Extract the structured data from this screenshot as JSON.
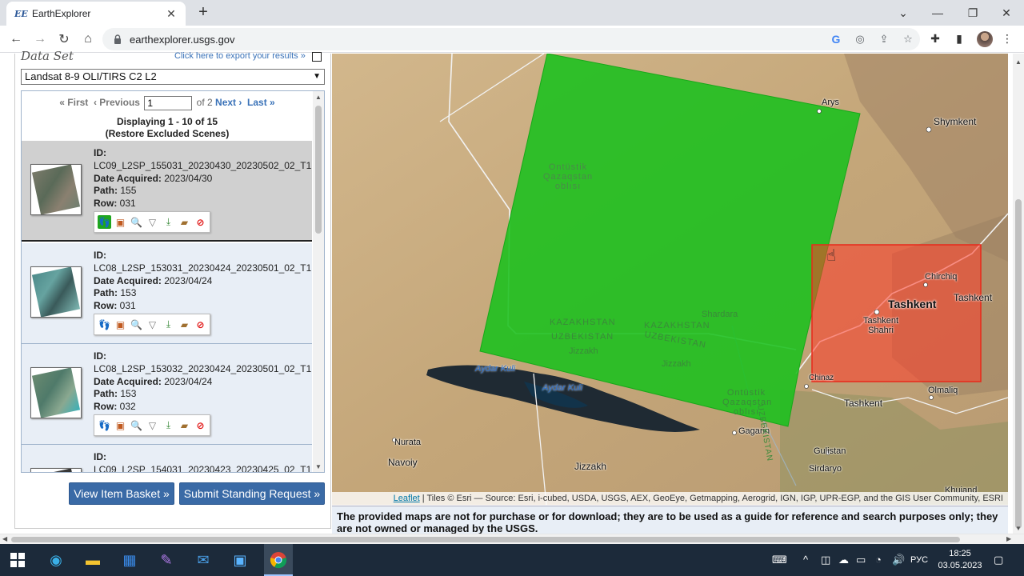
{
  "browser": {
    "tab_favicon": "EE",
    "tab_title": "EarthExplorer",
    "url": "earthexplorer.usgs.gov",
    "new_tab": "+"
  },
  "panel": {
    "dataset_label": "Data Set",
    "export_link": "Click here to export your results »",
    "dataset_selected": "Landsat 8-9 OLI/TIRS C2 L2",
    "pager": {
      "first": "« First",
      "previous": "‹ Previous",
      "page_value": "1",
      "of_text": "of 2",
      "next": "Next ›",
      "last": "Last »"
    },
    "displaying": "Displaying 1 - 10 of 15",
    "restore": "(Restore Excluded Scenes)",
    "labels": {
      "id": "ID:",
      "date": "Date Acquired:",
      "path": "Path:",
      "row": "Row:"
    },
    "scenes": [
      {
        "id": "LC09_L2SP_155031_20230430_20230502_02_T1",
        "date": "2023/04/30",
        "path": "155",
        "row": "031"
      },
      {
        "id": "LC08_L2SP_153031_20230424_20230501_02_T1",
        "date": "2023/04/24",
        "path": "153",
        "row": "031"
      },
      {
        "id": "LC08_L2SP_153032_20230424_20230501_02_T1",
        "date": "2023/04/24",
        "path": "153",
        "row": "032"
      },
      {
        "id": "LC09_L2SP_154031_20230423_20230425_02_T1"
      }
    ],
    "buttons": {
      "basket": "View Item Basket »",
      "standing": "Submit Standing Request »"
    }
  },
  "map": {
    "labels": {
      "arys": "Arys",
      "shymkent": "Shymkent",
      "ontustik": "Ontüstik Qazaqstan oblısı",
      "kaz1": "KAZAKHSTAN",
      "uzb1": "UZBEKISTAN",
      "kaz2": "KAZAKHSTAN",
      "uzb2": "UZBEKISTAN",
      "jizzakh1": "Jizzakh",
      "jizzakh2": "Jizzakh",
      "jizzakh3": "Jizzakh",
      "shardara": "Shardara",
      "aydarkul1": "Aydar Kuli",
      "aydarkul2": "Aydar Kuli",
      "chirchiq": "Chirchiq",
      "tashkent_big": "Tashkent",
      "tashkent_r": "Tashkent",
      "tashkent_shahri": "Tashkent Shahri",
      "chinaz": "Chinaz",
      "tashkent_region": "Tashkent",
      "olmaliq": "Olmaliq",
      "gagarin": "Gagarin",
      "gulistan": "Gulistan",
      "sirdaryo": "Sirdaryo",
      "nurata": "Nurata",
      "navoiy": "Navoiy",
      "khujand": "Khujand",
      "ontustik2": "Ontüstik Qazaqstan oblısı",
      "uzbekistan_v": "UZBEKISTAN"
    },
    "attribution_link": "Leaflet",
    "attribution_text": " | Tiles © Esri — Source: Esri, i-cubed, USDA, USGS, AEX, GeoEye, Getmapping, Aerogrid, IGN, IGP, UPR-EGP, and the GIS User Community, ESRI",
    "footprint_green": "#19c01c",
    "footprint_red": "#ff3b28"
  },
  "disclaimer": "The provided maps are not for purchase or for download; they are to be used as a guide for reference and search purposes only; they are not owned or managed by the USGS.",
  "taskbar": {
    "keyboard_lang": "РУС",
    "time": "18:25",
    "date": "03.05.2023"
  }
}
